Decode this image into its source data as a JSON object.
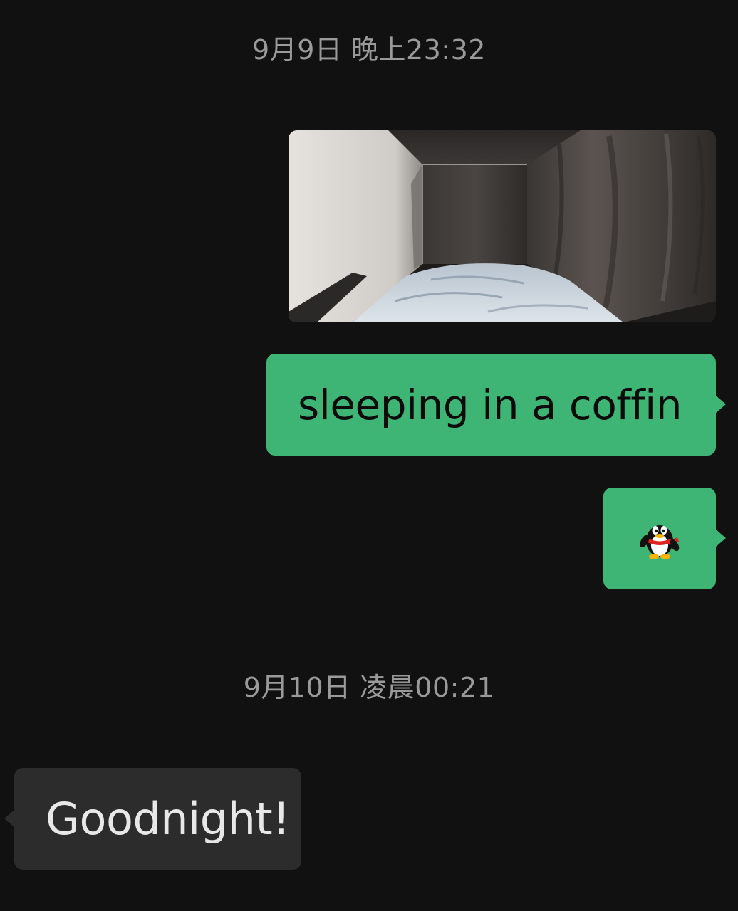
{
  "timestamps": {
    "first": "9月9日 晚上23:32",
    "second": "9月10日 凌晨00:21"
  },
  "messages": [
    {
      "side": "right",
      "type": "image",
      "description_icon": "photo-thumbnail"
    },
    {
      "side": "right",
      "type": "text",
      "text": "sleeping in a coffin"
    },
    {
      "side": "right",
      "type": "sticker",
      "icon": "penguin-icon"
    },
    {
      "side": "left",
      "type": "text",
      "text": "Goodnight!"
    }
  ],
  "colors": {
    "background": "#111111",
    "outgoing_bubble": "#3eb575",
    "incoming_bubble": "#2c2c2c",
    "timestamp_text": "#9a9a9a"
  }
}
